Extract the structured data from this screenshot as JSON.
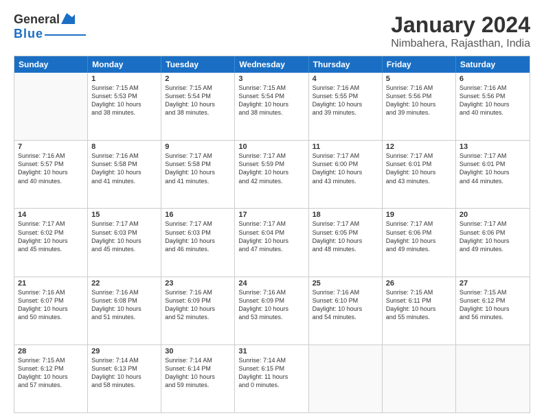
{
  "header": {
    "logo_general": "General",
    "logo_blue": "Blue",
    "month_title": "January 2024",
    "location": "Nimbahera, Rajasthan, India"
  },
  "days_of_week": [
    "Sunday",
    "Monday",
    "Tuesday",
    "Wednesday",
    "Thursday",
    "Friday",
    "Saturday"
  ],
  "weeks": [
    [
      {
        "day": "",
        "info": ""
      },
      {
        "day": "1",
        "info": "Sunrise: 7:15 AM\nSunset: 5:53 PM\nDaylight: 10 hours\nand 38 minutes."
      },
      {
        "day": "2",
        "info": "Sunrise: 7:15 AM\nSunset: 5:54 PM\nDaylight: 10 hours\nand 38 minutes."
      },
      {
        "day": "3",
        "info": "Sunrise: 7:15 AM\nSunset: 5:54 PM\nDaylight: 10 hours\nand 38 minutes."
      },
      {
        "day": "4",
        "info": "Sunrise: 7:16 AM\nSunset: 5:55 PM\nDaylight: 10 hours\nand 39 minutes."
      },
      {
        "day": "5",
        "info": "Sunrise: 7:16 AM\nSunset: 5:56 PM\nDaylight: 10 hours\nand 39 minutes."
      },
      {
        "day": "6",
        "info": "Sunrise: 7:16 AM\nSunset: 5:56 PM\nDaylight: 10 hours\nand 40 minutes."
      }
    ],
    [
      {
        "day": "7",
        "info": "Sunrise: 7:16 AM\nSunset: 5:57 PM\nDaylight: 10 hours\nand 40 minutes."
      },
      {
        "day": "8",
        "info": "Sunrise: 7:16 AM\nSunset: 5:58 PM\nDaylight: 10 hours\nand 41 minutes."
      },
      {
        "day": "9",
        "info": "Sunrise: 7:17 AM\nSunset: 5:58 PM\nDaylight: 10 hours\nand 41 minutes."
      },
      {
        "day": "10",
        "info": "Sunrise: 7:17 AM\nSunset: 5:59 PM\nDaylight: 10 hours\nand 42 minutes."
      },
      {
        "day": "11",
        "info": "Sunrise: 7:17 AM\nSunset: 6:00 PM\nDaylight: 10 hours\nand 43 minutes."
      },
      {
        "day": "12",
        "info": "Sunrise: 7:17 AM\nSunset: 6:01 PM\nDaylight: 10 hours\nand 43 minutes."
      },
      {
        "day": "13",
        "info": "Sunrise: 7:17 AM\nSunset: 6:01 PM\nDaylight: 10 hours\nand 44 minutes."
      }
    ],
    [
      {
        "day": "14",
        "info": "Sunrise: 7:17 AM\nSunset: 6:02 PM\nDaylight: 10 hours\nand 45 minutes."
      },
      {
        "day": "15",
        "info": "Sunrise: 7:17 AM\nSunset: 6:03 PM\nDaylight: 10 hours\nand 45 minutes."
      },
      {
        "day": "16",
        "info": "Sunrise: 7:17 AM\nSunset: 6:03 PM\nDaylight: 10 hours\nand 46 minutes."
      },
      {
        "day": "17",
        "info": "Sunrise: 7:17 AM\nSunset: 6:04 PM\nDaylight: 10 hours\nand 47 minutes."
      },
      {
        "day": "18",
        "info": "Sunrise: 7:17 AM\nSunset: 6:05 PM\nDaylight: 10 hours\nand 48 minutes."
      },
      {
        "day": "19",
        "info": "Sunrise: 7:17 AM\nSunset: 6:06 PM\nDaylight: 10 hours\nand 49 minutes."
      },
      {
        "day": "20",
        "info": "Sunrise: 7:17 AM\nSunset: 6:06 PM\nDaylight: 10 hours\nand 49 minutes."
      }
    ],
    [
      {
        "day": "21",
        "info": "Sunrise: 7:16 AM\nSunset: 6:07 PM\nDaylight: 10 hours\nand 50 minutes."
      },
      {
        "day": "22",
        "info": "Sunrise: 7:16 AM\nSunset: 6:08 PM\nDaylight: 10 hours\nand 51 minutes."
      },
      {
        "day": "23",
        "info": "Sunrise: 7:16 AM\nSunset: 6:09 PM\nDaylight: 10 hours\nand 52 minutes."
      },
      {
        "day": "24",
        "info": "Sunrise: 7:16 AM\nSunset: 6:09 PM\nDaylight: 10 hours\nand 53 minutes."
      },
      {
        "day": "25",
        "info": "Sunrise: 7:16 AM\nSunset: 6:10 PM\nDaylight: 10 hours\nand 54 minutes."
      },
      {
        "day": "26",
        "info": "Sunrise: 7:15 AM\nSunset: 6:11 PM\nDaylight: 10 hours\nand 55 minutes."
      },
      {
        "day": "27",
        "info": "Sunrise: 7:15 AM\nSunset: 6:12 PM\nDaylight: 10 hours\nand 56 minutes."
      }
    ],
    [
      {
        "day": "28",
        "info": "Sunrise: 7:15 AM\nSunset: 6:12 PM\nDaylight: 10 hours\nand 57 minutes."
      },
      {
        "day": "29",
        "info": "Sunrise: 7:14 AM\nSunset: 6:13 PM\nDaylight: 10 hours\nand 58 minutes."
      },
      {
        "day": "30",
        "info": "Sunrise: 7:14 AM\nSunset: 6:14 PM\nDaylight: 10 hours\nand 59 minutes."
      },
      {
        "day": "31",
        "info": "Sunrise: 7:14 AM\nSunset: 6:15 PM\nDaylight: 11 hours\nand 0 minutes."
      },
      {
        "day": "",
        "info": ""
      },
      {
        "day": "",
        "info": ""
      },
      {
        "day": "",
        "info": ""
      }
    ]
  ]
}
